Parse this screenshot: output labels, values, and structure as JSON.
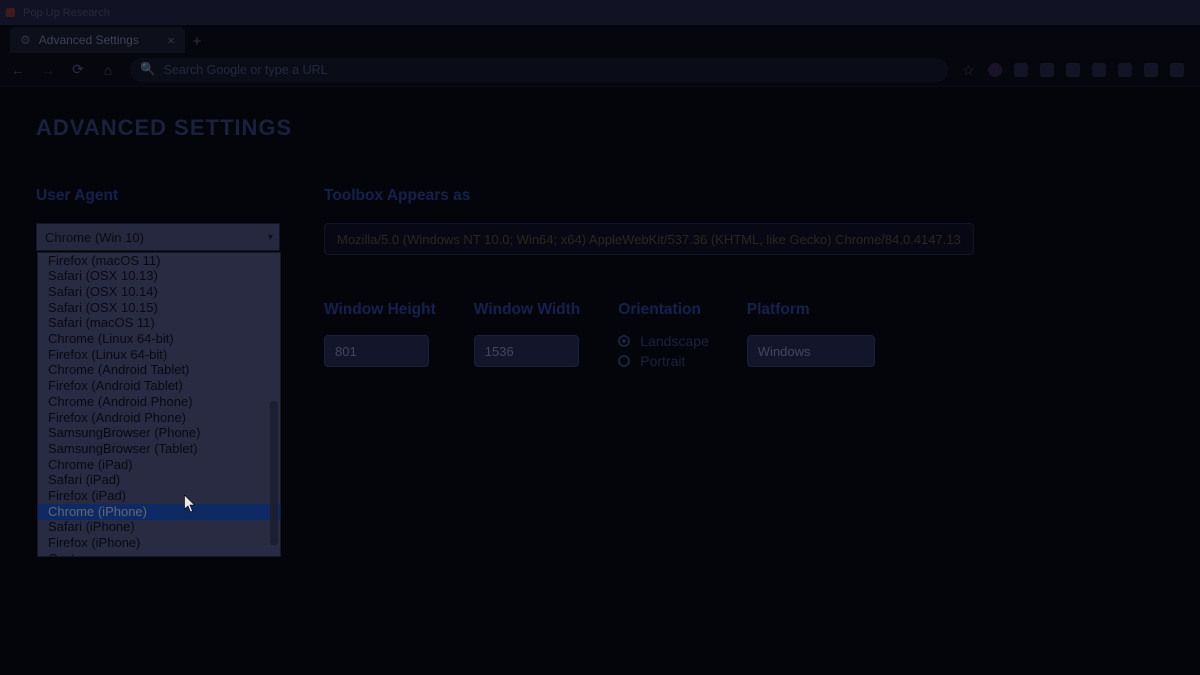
{
  "os_title": "Pop Up Research",
  "browser": {
    "tab_title": "Advanced Settings",
    "url_placeholder": "Search Google or type a URL"
  },
  "page": {
    "title": "ADVANCED SETTINGS",
    "labels": {
      "user_agent": "User Agent",
      "toolbox": "Toolbox Appears as",
      "win_height": "Window Height",
      "win_width": "Window Width",
      "orientation": "Orientation",
      "platform": "Platform"
    },
    "user_agent_selected": "Chrome (Win 10)",
    "user_agent_options": [
      "Firefox (macOS 11)",
      "Safari (OSX 10.13)",
      "Safari (OSX 10.14)",
      "Safari (OSX 10.15)",
      "Safari (macOS 11)",
      "Chrome (Linux 64-bit)",
      "Firefox (Linux 64-bit)",
      "Chrome (Android Tablet)",
      "Firefox (Android Tablet)",
      "Chrome (Android Phone)",
      "Firefox (Android Phone)",
      "SamsungBrowser (Phone)",
      "SamsungBrowser (Tablet)",
      "Chrome (iPad)",
      "Safari (iPad)",
      "Firefox (iPad)",
      "Chrome (iPhone)",
      "Safari (iPhone)",
      "Firefox (iPhone)",
      "Custom..."
    ],
    "highlighted_option_index": 16,
    "toolbox_value": "Mozilla/5.0 (Windows NT 10.0; Win64; x64) AppleWebKit/537.36 (KHTML, like Gecko) Chrome/84.0.4147.13",
    "window_height": "801",
    "window_width": "1536",
    "orientation": {
      "landscape": "Landscape",
      "portrait": "Portrait",
      "selected": "landscape"
    },
    "platform": "Windows"
  }
}
